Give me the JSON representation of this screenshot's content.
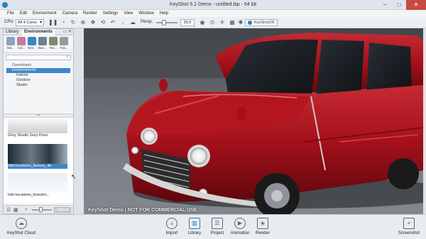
{
  "window": {
    "title": "KeyShot 5.1 Demo - untitled.bip - 64 bit",
    "controls": {
      "minimize": "–",
      "maximize": "□",
      "close": "✕"
    }
  },
  "menu": [
    "File",
    "Edit",
    "Environment",
    "Camera",
    "Render",
    "Settings",
    "View",
    "Window",
    "Help"
  ],
  "toolbar": {
    "cpu_label": "CPU",
    "cpu_value": "All 4 Cores",
    "perspective_label": "Persp.",
    "perspective_value": "35.0",
    "keyshot_button": "KeyShotXR",
    "icons": [
      "pause-icon",
      "performance-icon",
      "refresh-icon",
      "zoom-icon",
      "pan-icon",
      "rotate-icon",
      "undo-icon",
      "redo-icon",
      "cloud-icon",
      "camera-icon",
      "focus-icon",
      "move-icon",
      "grid-icon",
      "lights-icon"
    ]
  },
  "library_panel": {
    "tabs": [
      "Library",
      "Environments"
    ],
    "active_tab": "Environments",
    "categories": [
      {
        "label": "Ma...",
        "icon": "materials-icon"
      },
      {
        "label": "Col...",
        "icon": "colors-icon"
      },
      {
        "label": "Env...",
        "icon": "environments-icon",
        "selected": true
      },
      {
        "label": "Bac...",
        "icon": "backplates-icon"
      },
      {
        "label": "Tex...",
        "icon": "textures-icon"
      },
      {
        "label": "Fav...",
        "icon": "favorites-icon"
      }
    ],
    "tree": {
      "downloads": "Downloads",
      "environments": "Environments",
      "children": [
        "Interior",
        "Outdoor",
        "Studio"
      ]
    },
    "thumbnails": [
      {
        "name": "Grey Studio Grey Floor"
      },
      {
        "name": "hdri-locations_factory_4k",
        "selected": true
      },
      {
        "name": "hdri-locations_forestro..."
      }
    ],
    "upload_button": "Upload"
  },
  "viewport": {
    "watermark": "KeyShot Demo | NOT FOR COMMERCIAL USE"
  },
  "bottom_bar": {
    "left": {
      "label": "KeyShot Cloud",
      "icon": "cloud-icon"
    },
    "items": [
      {
        "label": "Import",
        "icon": "import-icon"
      },
      {
        "label": "Library",
        "icon": "library-icon",
        "active": true
      },
      {
        "label": "Project",
        "icon": "project-icon"
      },
      {
        "label": "Animation",
        "icon": "animation-icon"
      },
      {
        "label": "Render",
        "icon": "render-icon"
      }
    ],
    "right": {
      "label": "Screenshot",
      "icon": "screenshot-icon"
    }
  },
  "colors": {
    "accent": "#3d87c8",
    "car_body": "#a3101a",
    "close_button": "#c94b45"
  }
}
